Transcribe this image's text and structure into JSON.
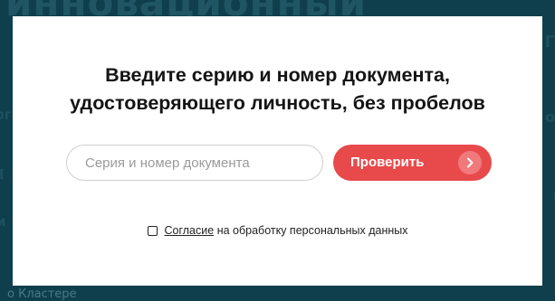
{
  "background": {
    "color": "#0f3f4c",
    "ghost_title": "инновационный",
    "ghost_bottom": "о Кластере"
  },
  "modal": {
    "heading_line1": "Введите серию и номер документа,",
    "heading_line2": "удостоверяющего личность, без пробелов",
    "input": {
      "value": "",
      "placeholder": "Серия и номер документа"
    },
    "button": {
      "label": "Проверить",
      "icon": "chevron-right-icon",
      "color": "#e84a4c"
    },
    "consent": {
      "checked": false,
      "link_text": "Согласие",
      "text": "на обработку персональных данных"
    }
  }
}
